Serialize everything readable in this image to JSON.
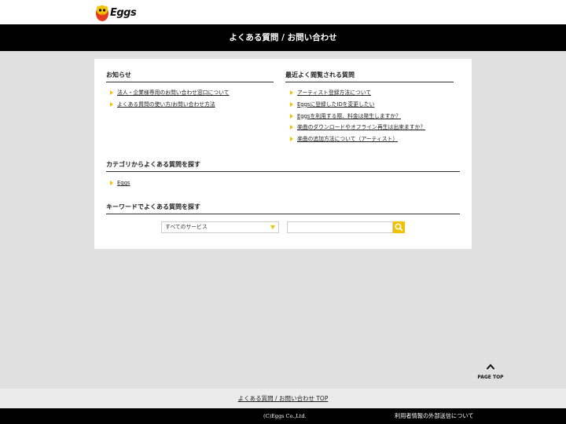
{
  "header": {
    "logo_text": "Eggs",
    "title": "よくある質問 / お問い合わせ"
  },
  "news": {
    "title": "お知らせ",
    "items": [
      "法人・企業様専用のお問い合わせ窓口について",
      "よくある質問の使い方/お問い合わせ方法"
    ]
  },
  "popular": {
    "title": "最近よく閲覧される質問",
    "items": [
      "アーティスト登録方法について",
      "Eggsに登録したIDを変更したい",
      "Eggsを利用する際、料金は発生しますか？",
      "楽曲のダウンロードやオフライン再生は出来ますか？",
      "楽曲の追加方法について（アーティスト）"
    ]
  },
  "categories": {
    "title": "カテゴリからよくある質問を探す",
    "items": [
      "Eggs"
    ]
  },
  "keyword": {
    "title": "キーワードでよくある質問を探す",
    "select_value": "すべてのサービス",
    "input_value": ""
  },
  "page_top": {
    "label": "PAGE TOP"
  },
  "footer": {
    "top_link": "よくある質問 / お問い合わせ TOP",
    "copyright": "(C)Eggs Co.,Ltd.",
    "external_link": "利用者情報の外部送信について"
  },
  "colors": {
    "accent": "#f2c200",
    "header_bg": "#000000",
    "page_bg": "#e0e0e0"
  }
}
